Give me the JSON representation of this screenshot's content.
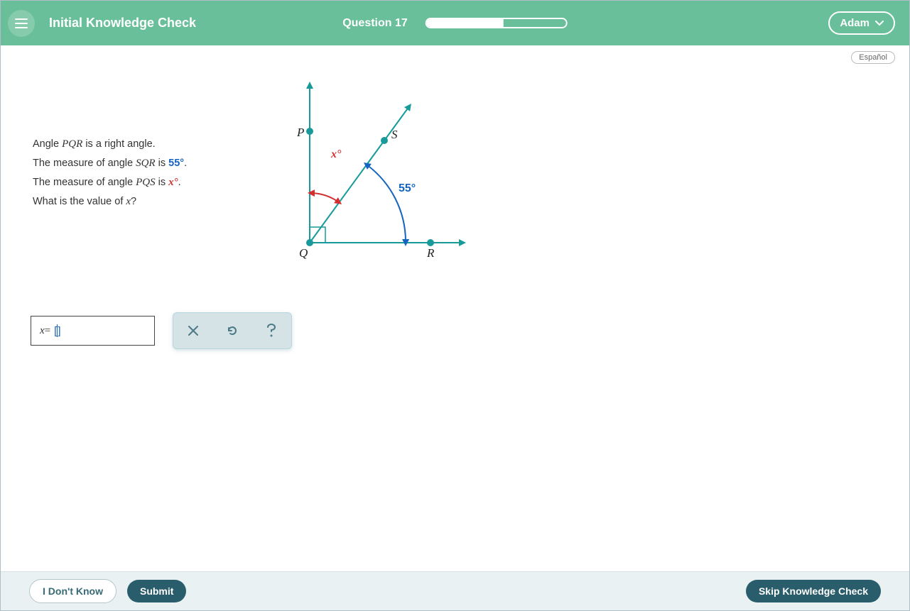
{
  "header": {
    "title": "Initial Knowledge Check",
    "question_label": "Question 17",
    "progress_percent": 55,
    "user_name": "Adam"
  },
  "language_button": "Español",
  "problem": {
    "line1_prefix": "Angle ",
    "line1_angle": "PQR",
    "line1_suffix": " is a right angle.",
    "line2_prefix": "The measure of angle ",
    "line2_angle": "SQR",
    "line2_mid": " is ",
    "line2_value": "55°",
    "line2_suffix": ".",
    "line3_prefix": "The measure of angle ",
    "line3_angle": "PQS",
    "line3_mid": " is ",
    "line3_value": "x°",
    "line3_suffix": ".",
    "line4": "What is the value of x?"
  },
  "diagram": {
    "label_P": "P",
    "label_Q": "Q",
    "label_R": "R",
    "label_S": "S",
    "angle_sqr_label": "55°",
    "angle_pqs_label": "x°"
  },
  "answer": {
    "prefix_var": "x",
    "prefix_eq": " = ",
    "value": ""
  },
  "footer": {
    "idk": "I Don't Know",
    "submit": "Submit",
    "skip": "Skip Knowledge Check"
  },
  "chart_data": {
    "type": "diagram",
    "description": "Right angle PQR at vertex Q. Ray QP is vertical (up), ray QR is horizontal (right). Ray QS lies between them. Angle SQR (between QS and QR) = 55°. Angle PQS (between QP and QS) = x°.",
    "points": [
      "P",
      "Q",
      "R",
      "S"
    ],
    "angles": {
      "PQR": 90,
      "SQR": 55,
      "PQS": "x"
    }
  }
}
